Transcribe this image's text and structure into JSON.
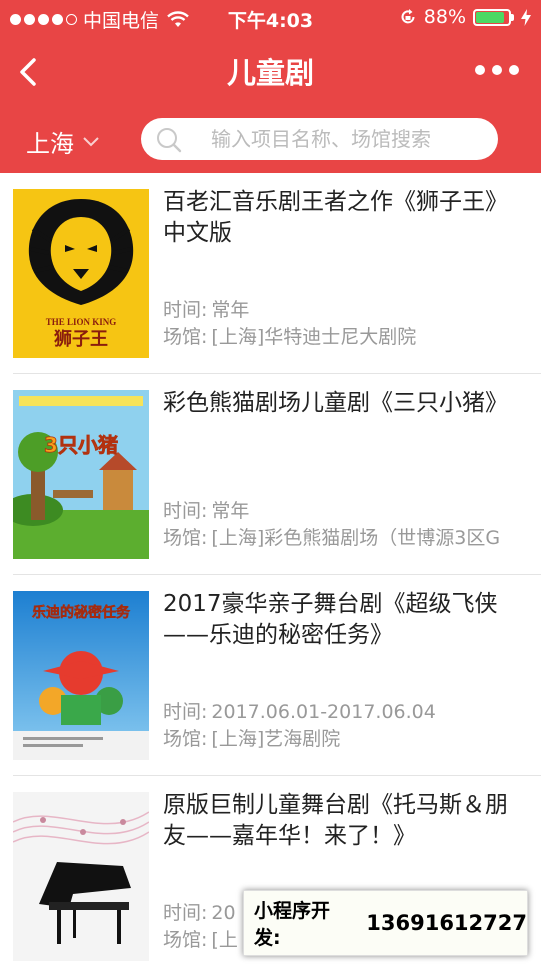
{
  "status_bar": {
    "carrier": "中国电信",
    "time": "下午4:03",
    "battery": "88%",
    "battery_level": 0.88
  },
  "nav": {
    "title": "儿童剧"
  },
  "filter": {
    "city": "上海",
    "search_placeholder": "输入项目名称、场馆搜索"
  },
  "labels": {
    "time": "时间:",
    "venue": "场馆:"
  },
  "items": [
    {
      "title": "百老汇音乐剧王者之作《狮子王》中文版",
      "time": "常年",
      "venue": "[上海]华特迪士尼大剧院",
      "poster": {
        "mark": "THE LION KING",
        "cn": "狮子王"
      }
    },
    {
      "title": "彩色熊猫剧场儿童剧《三只小猪》",
      "time": "常年",
      "venue": "[上海]彩色熊猫剧场（世博源3区G",
      "poster": {
        "mark": "3只小猪"
      }
    },
    {
      "title": "2017豪华亲子舞台剧《超级飞侠——乐迪的秘密任务》",
      "time": "2017.06.01-2017.06.04",
      "venue": "[上海]艺海剧院",
      "poster": {
        "mark": "乐迪的秘密任务"
      }
    },
    {
      "title": "原版巨制儿童舞台剧《托马斯＆朋友——嘉年华！来了！》",
      "time": "20",
      "venue": "[上",
      "poster": {}
    }
  ],
  "promo": {
    "label": "小程序开发:",
    "phone": "13691612727"
  },
  "colors": {
    "header_bg": "#E84545",
    "battery_green": "#4CD964"
  }
}
